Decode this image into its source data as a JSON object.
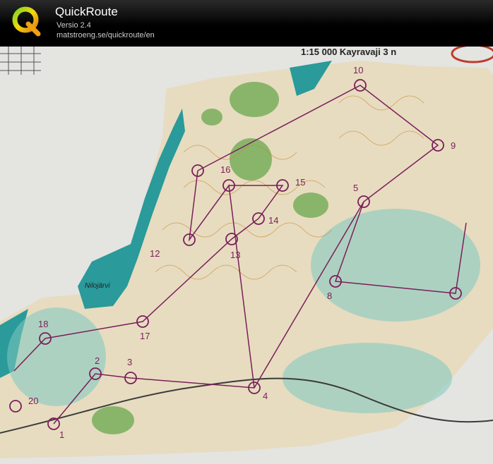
{
  "app": {
    "title": "QuickRoute",
    "version": "Versio 2.4",
    "url": "matstroeng.se/quickroute/en",
    "logo_icon": "quickroute-q-logo-icon"
  },
  "map": {
    "scale_label": "1:15 000  Kayravaji 3 n",
    "lake_label": "Nilojärvi",
    "controls": [
      "1",
      "2",
      "3",
      "4",
      "5",
      "8",
      "9",
      "10",
      "12",
      "13",
      "14",
      "15",
      "16",
      "17",
      "18",
      "20"
    ],
    "colors": {
      "course": "#7a1f5a",
      "water": "#2a9a9a",
      "forest": "#6aa84f",
      "paper": "#e6e6e3"
    }
  }
}
